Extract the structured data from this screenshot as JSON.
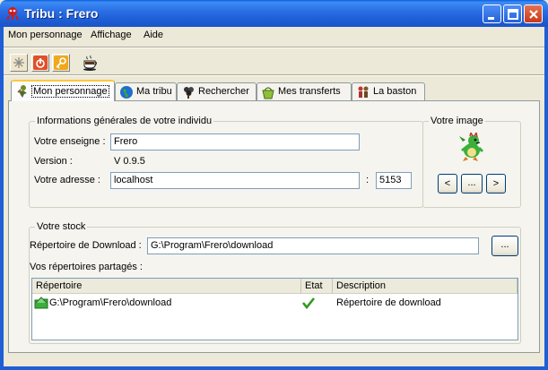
{
  "window": {
    "title": "Tribu : Frero"
  },
  "menu": [
    "Mon personnage",
    "Affichage",
    "Aide"
  ],
  "toolbar": {
    "buttons": [
      {
        "icon": "snowflake-icon"
      },
      {
        "icon": "power-icon"
      },
      {
        "icon": "key-icon"
      },
      {
        "icon": "coffee-cup-icon"
      }
    ]
  },
  "tabs": [
    {
      "label": "Mon personnage",
      "icon": "character-icon",
      "active": true
    },
    {
      "label": "Ma tribu",
      "icon": "globe-icon"
    },
    {
      "label": "Rechercher",
      "icon": "search-tree-icon"
    },
    {
      "label": "Mes transferts",
      "icon": "basket-icon"
    },
    {
      "label": "La baston",
      "icon": "fighters-icon"
    }
  ],
  "info": {
    "group_title": "Informations générales de votre individu",
    "enseigne_label": "Votre enseigne :",
    "enseigne_value": "Frero",
    "version_label": "Version :",
    "version_value": "V 0.9.5",
    "adresse_label": "Votre adresse :",
    "adresse_value": "localhost",
    "port_sep": ":",
    "port_value": "5153"
  },
  "image": {
    "group_title": "Votre image",
    "prev_label": "<",
    "browse_label": "...",
    "next_label": ">"
  },
  "stock": {
    "group_title": "Votre stock",
    "download_label": "Répertoire de Download :",
    "download_value": "G:\\Program\\Frero\\download",
    "browse_label": "...",
    "shared_label": "Vos répertoires partagés :",
    "columns": [
      "Répertoire",
      "Etat",
      "Description"
    ],
    "rows": [
      {
        "directory": "G:\\Program\\Frero\\download",
        "status": "ok",
        "description": "Répertoire de download"
      }
    ]
  },
  "colors": {
    "title_bar": "#1f5fd6",
    "active_tab_accent": "#ffc83c",
    "check_green": "#2e9a1e"
  }
}
